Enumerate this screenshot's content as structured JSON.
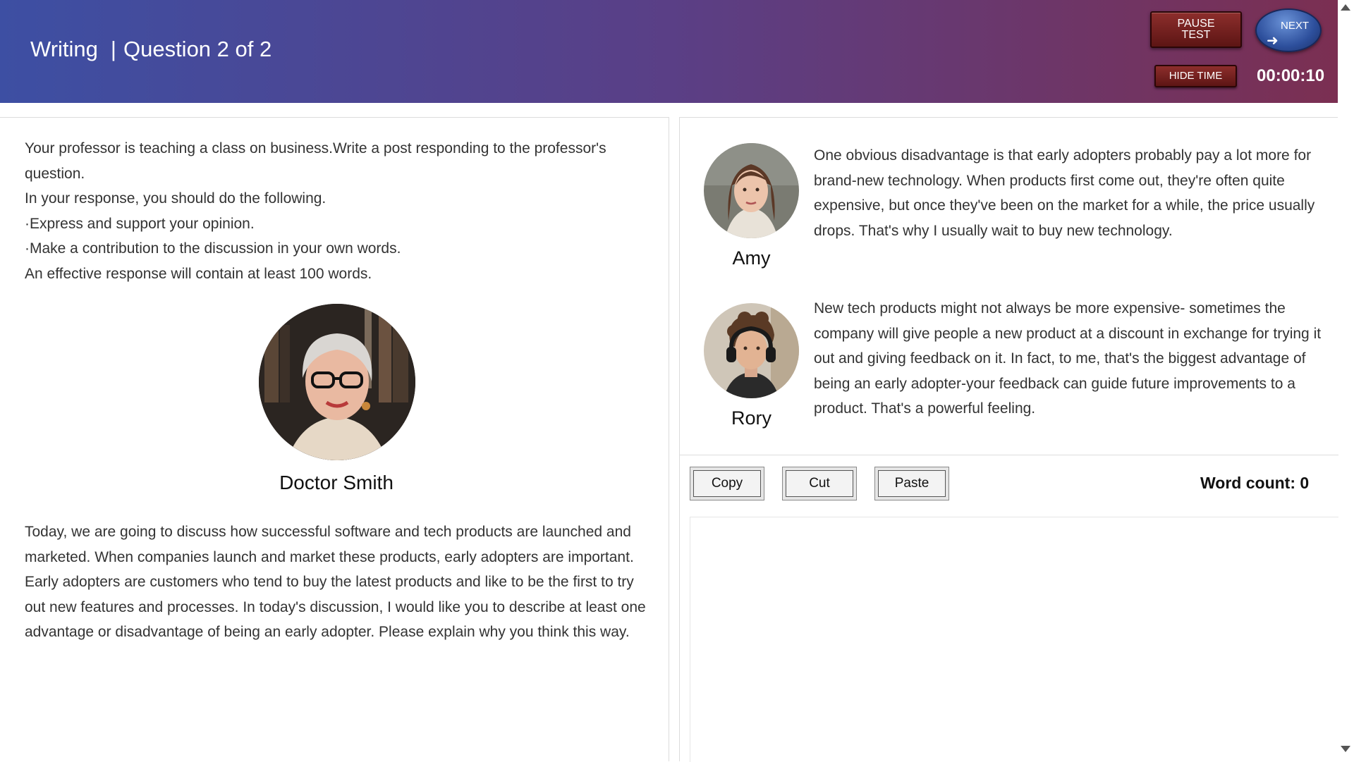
{
  "header": {
    "section": "Writing",
    "separator": "|",
    "question": "Question 2 of 2",
    "pause_label_1": "PAUSE",
    "pause_label_2": "TEST",
    "next_label": "NEXT",
    "next_arrow": "➜",
    "hide_time_label": "HIDE TIME",
    "timer": "00:00:10"
  },
  "prompt": {
    "lines": [
      "Your professor is teaching a class on business.Write a post responding to the professor's question.",
      "In your response, you should do the following.",
      "·Express and support your opinion.",
      "·Make a contribution to the discussion in your own words.",
      "An effective response will contain at least 100 words."
    ]
  },
  "professor": {
    "name": "Doctor Smith",
    "text": "Today, we are going to discuss how successful software and tech products are launched and marketed. When companies launch and market these products, early adopters are important. Early adopters are customers who tend to buy the latest products and like to be the first to try out new features and processes. In today's discussion, I would like you to describe at least one advantage or disadvantage of being an early adopter. Please explain why you think this way."
  },
  "students": [
    {
      "name": "Amy",
      "text": "One obvious disadvantage is that early adopters probably pay a lot more for brand-new technology. When products first come out, they're often quite expensive, but once they've been on the market for a while, the price usually drops. That's why I usually wait to buy new technology."
    },
    {
      "name": "Rory",
      "text": "New tech products might not always be more expensive- sometimes the company will give people a new product at a discount in exchange for trying it out and giving feedback on it. In fact, to me, that's the biggest advantage of being an early adopter-your feedback can guide future improvements to a product. That's a powerful feeling."
    }
  ],
  "toolbar": {
    "copy_label": "Copy",
    "cut_label": "Cut",
    "paste_label": "Paste",
    "word_count_label": "Word count:",
    "word_count_value": "0"
  },
  "editor": {
    "value": ""
  },
  "colors": {
    "header_start": "#3d4fa3",
    "header_end": "#7b2f52",
    "button_red": "#7a2422",
    "button_blue": "#2d4f9c"
  }
}
